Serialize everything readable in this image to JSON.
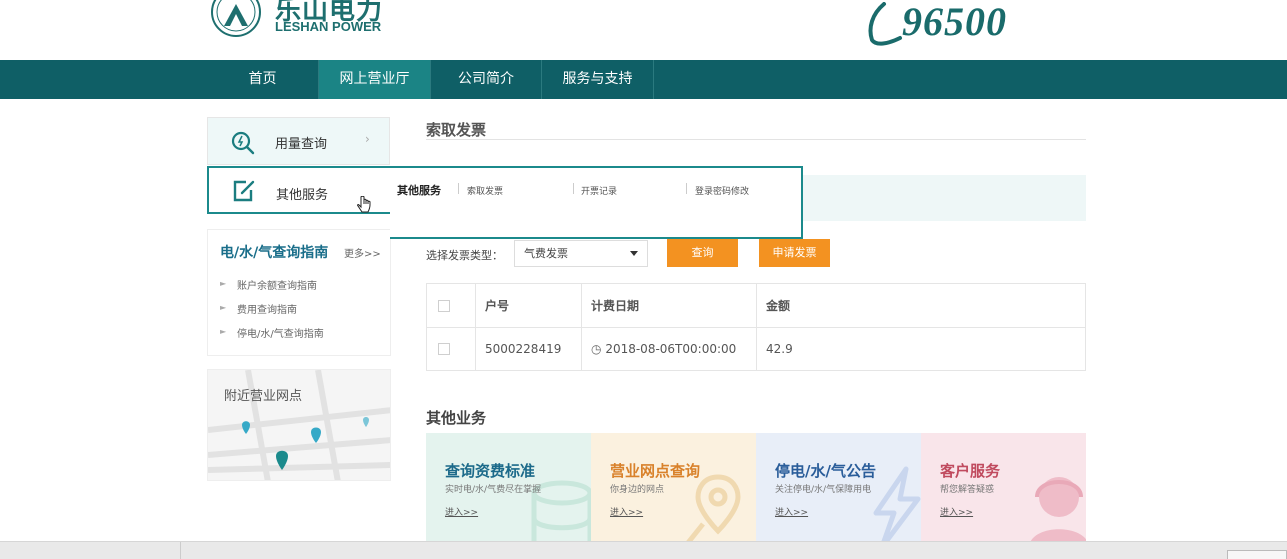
{
  "header": {
    "logo_cn": "乐山电力",
    "logo_en": "LESHAN POWER",
    "hotline": "96500"
  },
  "nav": {
    "items": [
      {
        "label": "首页"
      },
      {
        "label": "网上营业厅"
      },
      {
        "label": "公司简介"
      },
      {
        "label": "服务与支持"
      }
    ],
    "active_index": 1
  },
  "sidebar": {
    "usage_query": "用量查询",
    "other_services": "其他服务",
    "guide": {
      "title": "电/水/气查询指南",
      "more": "更多>>",
      "links": [
        "账户余额查询指南",
        "费用查询指南",
        "停电/水/气查询指南"
      ]
    },
    "nearby": "附近营业网点"
  },
  "popup": {
    "title": "其他服务",
    "links": [
      "索取发票",
      "开票记录",
      "登录密码修改"
    ]
  },
  "main": {
    "title": "索取发票",
    "type_label": "选择发票类型：",
    "type_value": "气费发票",
    "query_button": "查询",
    "apply_button": "申请发票",
    "table": {
      "headers": [
        "户号",
        "计费日期",
        "金额"
      ],
      "rows": [
        {
          "account": "5000228419",
          "date": "2018-08-06T00:00:00",
          "amount": "42.9"
        }
      ]
    },
    "other_title": "其他业务",
    "cards": [
      {
        "title": "查询资费标准",
        "sub": "实时电/水/气费尽在掌握",
        "link": "进入>>",
        "bg": "#e4f3ee",
        "color": "#1c6a8a"
      },
      {
        "title": "营业网点查询",
        "sub": "你身边的网点",
        "link": "进入>>",
        "bg": "#fbf1df",
        "color": "#d9822b"
      },
      {
        "title": "停电/水/气公告",
        "sub": "关注停电/水/气保障用电",
        "link": "进入>>",
        "bg": "#e8eef8",
        "color": "#2a5d9a"
      },
      {
        "title": "客户服务",
        "sub": "帮您解答疑惑",
        "link": "进入>>",
        "bg": "#f9e5ea",
        "color": "#c04a5e"
      }
    ]
  },
  "colors": {
    "nav_bg": "#0f5f66",
    "accent_teal": "#1b8a8c",
    "button_orange": "#f39221"
  }
}
